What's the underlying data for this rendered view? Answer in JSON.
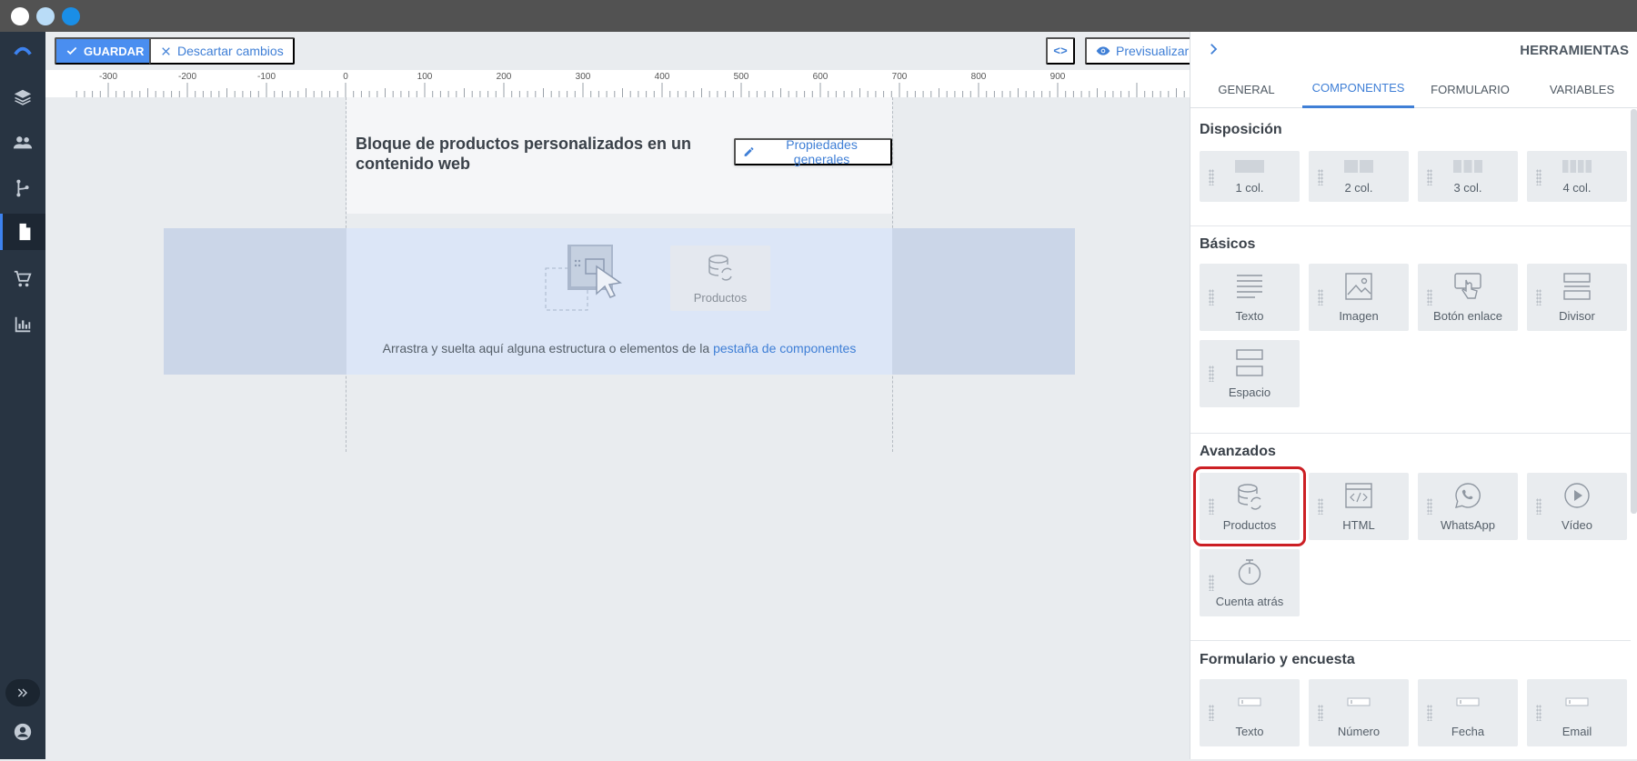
{
  "toolbar": {
    "save_label": "GUARDAR",
    "discard_label": "Descartar cambios",
    "code_label": "<>",
    "preview_label": "Previsualizar"
  },
  "ruler": {
    "labels": [
      "-300",
      "-200",
      "-100",
      "0",
      "100",
      "200",
      "300",
      "400",
      "500",
      "600",
      "700",
      "800",
      "900"
    ]
  },
  "canvas": {
    "block_title": "Bloque de productos personalizados en un contenido web",
    "props_button": "Propiedades generales",
    "drop_text": "Arrastra y suelta aquí alguna estructura o elementos de la ",
    "drop_link": "pestaña de componentes",
    "ghost_label": "Productos"
  },
  "panel": {
    "title": "HERRAMIENTAS",
    "tabs": [
      {
        "label": "GENERAL"
      },
      {
        "label": "COMPONENTES",
        "active": true
      },
      {
        "label": "FORMULARIO"
      },
      {
        "label": "VARIABLES"
      }
    ],
    "sections": [
      {
        "title": "Disposición",
        "items": [
          {
            "label": "1 col.",
            "icon": "one-column-icon"
          },
          {
            "label": "2 col.",
            "icon": "two-column-icon"
          },
          {
            "label": "3 col.",
            "icon": "three-column-icon"
          },
          {
            "label": "4 col.",
            "icon": "four-column-icon"
          }
        ]
      },
      {
        "title": "Básicos",
        "items": [
          {
            "label": "Texto",
            "icon": "text-icon"
          },
          {
            "label": "Imagen",
            "icon": "image-icon"
          },
          {
            "label": "Botón enlace",
            "icon": "link-button-icon"
          },
          {
            "label": "Divisor",
            "icon": "divider-icon"
          },
          {
            "label": "Espacio",
            "icon": "spacer-icon"
          }
        ]
      },
      {
        "title": "Avanzados",
        "items": [
          {
            "label": "Productos",
            "icon": "products-icon"
          },
          {
            "label": "HTML",
            "icon": "html-icon"
          },
          {
            "label": "WhatsApp",
            "icon": "whatsapp-icon"
          },
          {
            "label": "Vídeo",
            "icon": "video-icon"
          },
          {
            "label": "Cuenta atrás",
            "icon": "countdown-icon"
          }
        ]
      },
      {
        "title": "Formulario y encuesta",
        "items": [
          {
            "label": "Texto",
            "icon": "text-field-icon"
          },
          {
            "label": "Número",
            "icon": "number-field-icon"
          },
          {
            "label": "Fecha",
            "icon": "date-field-icon"
          },
          {
            "label": "Email",
            "icon": "email-field-icon"
          }
        ]
      }
    ]
  },
  "colors": {
    "accent": "#3f7fd6",
    "save_button": "#4a8ef0",
    "sidebar": "#283442",
    "highlight": "#cc1f24",
    "window_dots": [
      "#ffffff",
      "#b9dcf7",
      "#1a8ee6"
    ]
  }
}
